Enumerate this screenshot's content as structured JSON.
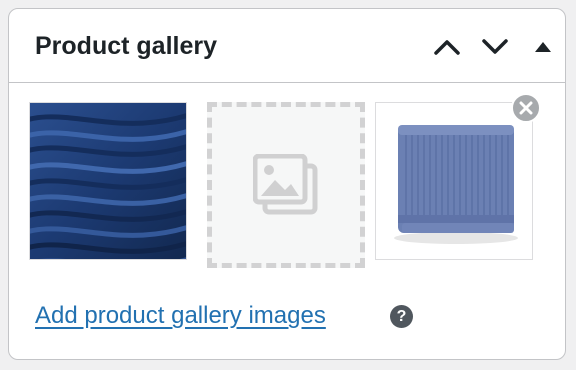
{
  "panel": {
    "title": "Product gallery",
    "move_up_icon": "chevron-up-icon",
    "move_down_icon": "chevron-down-icon",
    "toggle_icon": "triangle-up-icon"
  },
  "gallery": {
    "images": [
      {
        "name": "blue ribbed fabric close-up",
        "has_remove": false
      },
      {
        "name": "placeholder",
        "icon": "image-placeholder-icon"
      },
      {
        "name": "folded blue knit scarf",
        "has_remove": true
      }
    ],
    "remove_icon": "close-circle-icon"
  },
  "footer": {
    "add_link": "Add product gallery images",
    "help_glyph": "?",
    "help_icon": "help-icon"
  },
  "colors": {
    "link": "#2271b1",
    "title": "#1d2327",
    "border": "#c3c4c7",
    "help_bg": "#50575e"
  }
}
